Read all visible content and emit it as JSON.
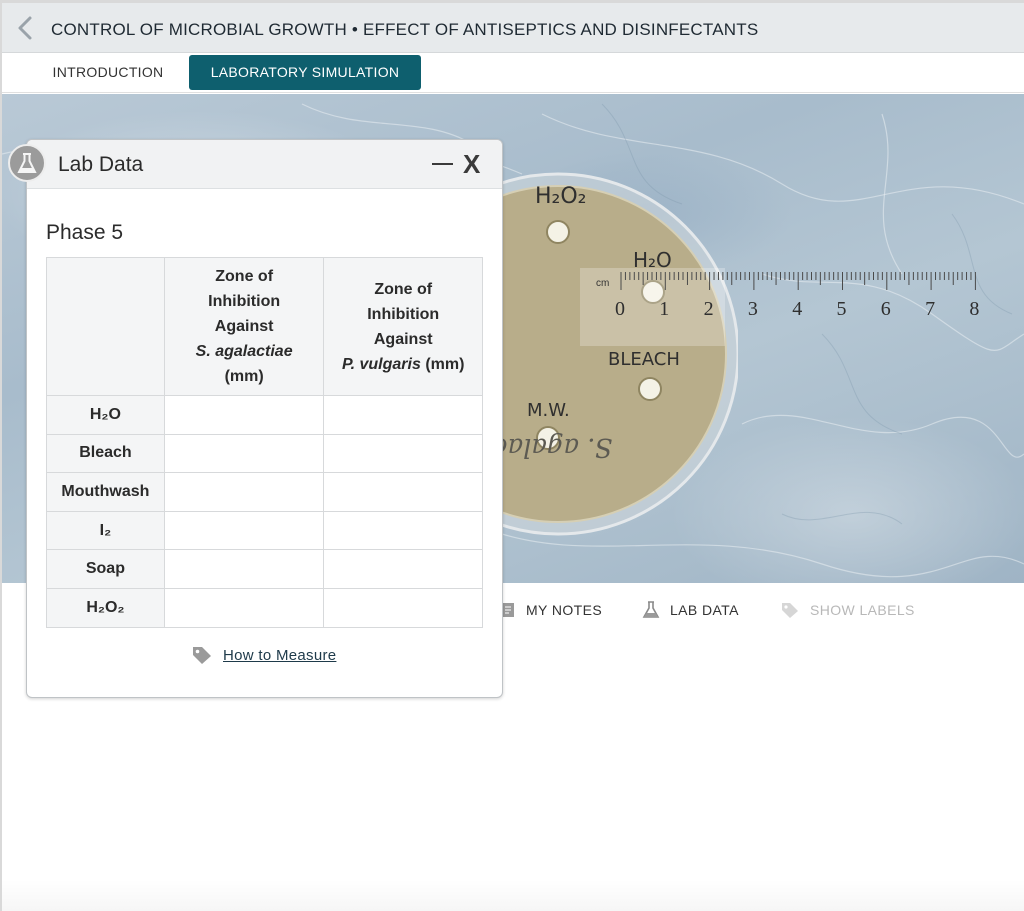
{
  "header": {
    "title": "CONTROL OF MICROBIAL GROWTH • EFFECT OF ANTISEPTICS AND DISINFECTANTS",
    "back_icon": "chevron-left-icon"
  },
  "tabs": [
    {
      "label": "INTRODUCTION",
      "active": false
    },
    {
      "label": "LABORATORY SIMULATION",
      "active": true
    }
  ],
  "colors": {
    "accent": "#0e5f6e",
    "agar": "#b8ad8a",
    "disabled": "#b8b8b8"
  },
  "dish": {
    "labels": {
      "h2o2": "H₂O₂",
      "h2o": "H₂O",
      "bleach": "BLEACH",
      "mw": "M.W.",
      "organism": "S. agalac"
    }
  },
  "ruler": {
    "unit": "cm",
    "numbers": [
      "0",
      "1",
      "2",
      "3",
      "4",
      "5",
      "6",
      "7",
      "8"
    ]
  },
  "toolbar": {
    "my_notes": "MY NOTES",
    "lab_data": "LAB DATA",
    "show_labels": "SHOW LABELS"
  },
  "lab_data_panel": {
    "title": "Lab Data",
    "phase": "Phase 5",
    "columns": [
      {
        "line1": "Zone of",
        "line2": "Inhibition",
        "line3": "Against",
        "organism": "S. agalactiae",
        "unit": "(mm)"
      },
      {
        "line1": "Zone of",
        "line2": "Inhibition",
        "line3": "Against",
        "organism": "P. vulgaris",
        "unit": "(mm)"
      }
    ],
    "rows": [
      {
        "label": "H₂O",
        "values": [
          "",
          ""
        ]
      },
      {
        "label": "Bleach",
        "values": [
          "",
          ""
        ]
      },
      {
        "label": "Mouthwash",
        "values": [
          "",
          ""
        ]
      },
      {
        "label": "I₂",
        "values": [
          "",
          ""
        ]
      },
      {
        "label": "Soap",
        "values": [
          "",
          ""
        ]
      },
      {
        "label": "H₂O₂",
        "values": [
          "",
          ""
        ]
      }
    ],
    "how_to_measure": "How to Measure",
    "minimize_icon": "minimize-icon",
    "close_label": "X"
  }
}
